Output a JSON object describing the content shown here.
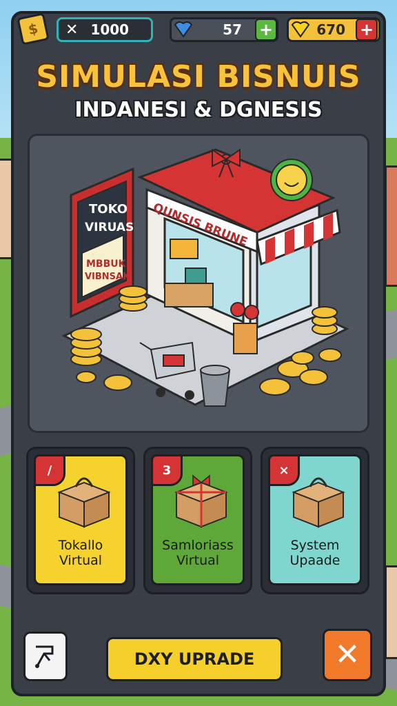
{
  "header": {
    "cash_icon": "cash-icon",
    "tool_value": "1000",
    "gems_value": "57",
    "coins_value": "670"
  },
  "title": {
    "main": "SIMULASI BISNUIS",
    "sub": "INDANESI & DGNESIS"
  },
  "scene": {
    "sign_line1": "TOKO",
    "sign_line2": "VIRUAS",
    "sign_line3": "MBBUK",
    "sign_line4": "VIBNSAK",
    "shop_sign": "QUNSIS BRUNE"
  },
  "cards": [
    {
      "badge": "/",
      "label_line1": "Tokallo",
      "label_line2": "Virtual",
      "color": "#f5d22e"
    },
    {
      "badge": "3",
      "label_line1": "Samloriass",
      "label_line2": "Virtual",
      "color": "#5ea83a"
    },
    {
      "badge": "×",
      "label_line1": "System",
      "label_line2": "Upaade",
      "color": "#7fd6cf"
    }
  ],
  "footer": {
    "upgrade_label": "DXY UPRADE"
  },
  "colors": {
    "panel": "#3a3f47",
    "title_gold": "#f6c33a",
    "accent_red": "#d43434",
    "close_orange": "#f07a2a"
  }
}
